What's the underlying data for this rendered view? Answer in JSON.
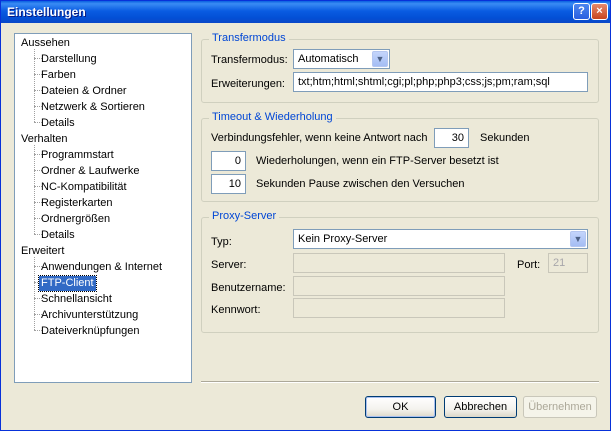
{
  "window": {
    "title": "Einstellungen",
    "help_glyph": "?",
    "close_glyph": "×"
  },
  "tree": {
    "categories": [
      {
        "label": "Aussehen",
        "children": [
          "Darstellung",
          "Farben",
          "Dateien & Ordner",
          "Netzwerk & Sortieren",
          "Details"
        ]
      },
      {
        "label": "Verhalten",
        "children": [
          "Programmstart",
          "Ordner & Laufwerke",
          "NC-Kompatibilität",
          "Registerkarten",
          "Ordnergrößen",
          "Details"
        ]
      },
      {
        "label": "Erweitert",
        "children": [
          "Anwendungen & Internet",
          "FTP-Client",
          "Schnellansicht",
          "Archivunterstützung",
          "Dateiverknüpfungen"
        ]
      }
    ],
    "selected": "FTP-Client"
  },
  "transfer": {
    "group_title": "Transfermodus",
    "mode_label": "Transfermodus:",
    "mode_value": "Automatisch",
    "ext_label": "Erweiterungen:",
    "ext_value": "txt;htm;html;shtml;cgi;pl;php;php3;css;js;pm;ram;sql"
  },
  "timeout": {
    "group_title": "Timeout & Wiederholung",
    "conn_error_label": "Verbindungsfehler, wenn keine Antwort nach",
    "conn_error_value": "30",
    "seconds_label": "Sekunden",
    "retries_value": "0",
    "retries_label": "Wiederholungen, wenn ein FTP-Server besetzt ist",
    "pause_value": "10",
    "pause_label": "Sekunden Pause zwischen den Versuchen"
  },
  "proxy": {
    "group_title": "Proxy-Server",
    "type_label": "Typ:",
    "type_value": "Kein Proxy-Server",
    "server_label": "Server:",
    "server_value": "",
    "port_label": "Port:",
    "port_value": "21",
    "user_label": "Benutzername:",
    "user_value": "",
    "password_label": "Kennwort:",
    "password_value": ""
  },
  "buttons": {
    "ok": "OK",
    "cancel": "Abbrechen",
    "apply": "Übernehmen"
  },
  "icons": {
    "dropdown_arrow": "chevron-down-icon"
  }
}
